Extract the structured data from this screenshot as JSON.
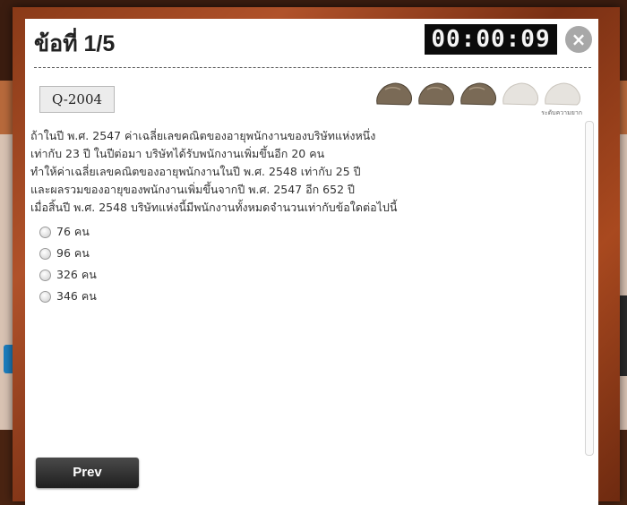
{
  "header": {
    "question_counter": "ข้อที่ 1/5",
    "timer": "00:00:09",
    "close_symbol": "×"
  },
  "question": {
    "code": "Q-2004",
    "difficulty": {
      "label": "ระดับความยาก",
      "filled": 3,
      "total": 5,
      "icon": "rock-icon",
      "filled_color": "#7a6a56",
      "empty_color": "#e6e3de"
    },
    "lines": [
      "ถ้าในปี พ.ศ. 2547 ค่าเฉลี่ยเลขคณิตของอายุพนักงานของบริษัทแห่งหนึ่ง",
      "เท่ากับ 23 ปี ในปีต่อมา บริษัทได้รับพนักงานเพิ่มขึ้นอีก 20 คน",
      "ทำให้ค่าเฉลี่ยเลขคณิตของอายุพนักงานในปี พ.ศ. 2548 เท่ากับ 25 ปี",
      "และผลรวมของอายุของพนักงานเพิ่มขึ้นจากปี พ.ศ. 2547 อีก 652 ปี",
      "เมื่อสิ้นปี พ.ศ. 2548 บริษัทแห่งนี้มีพนักงานทั้งหมดจำนวนเท่ากับข้อใดต่อไปนี้"
    ],
    "options": [
      "76 คน",
      "96 คน",
      "326 คน",
      "346 คน"
    ]
  },
  "footer": {
    "prev_label": "Prev"
  }
}
